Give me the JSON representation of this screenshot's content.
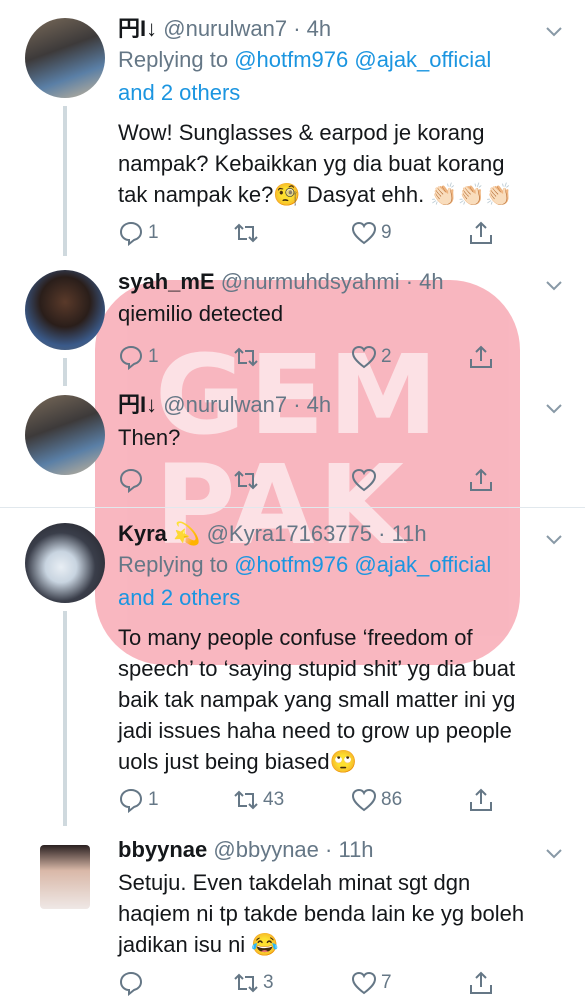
{
  "watermark": {
    "text": "GEM PAK"
  },
  "tweets": [
    {
      "name": "円I↓",
      "handle": "@nurulwan7",
      "time": "· 4h",
      "replying_prefix": "Replying to ",
      "replying_mentions": "@hotfm976 @ajak_official",
      "replying_others": "and 2 others",
      "body_lines": [
        "Wow! Sunglasses & earpod je korang",
        "nampak? Kebaikkan yg dia buat korang",
        "tak nampak ke?🧐 Dasyat ehh. 👏🏻👏🏻👏🏻"
      ],
      "replies": "1",
      "retweets": "",
      "likes": "9"
    },
    {
      "name": "syah_mE",
      "handle": "@nurmuhdsyahmi",
      "time": "· 4h",
      "body_lines": [
        "qiemilio detected"
      ],
      "replies": "1",
      "retweets": "",
      "likes": "2"
    },
    {
      "name": "円I↓",
      "handle": "@nurulwan7",
      "time": "· 4h",
      "body_lines": [
        "Then?"
      ],
      "replies": "",
      "retweets": "",
      "likes": ""
    },
    {
      "name": "Kyra 💫",
      "handle": "@Kyra17163775",
      "time": "· 11h",
      "replying_prefix": "Replying to ",
      "replying_mentions": "@hotfm976 @ajak_official",
      "replying_others": "and 2 others",
      "body_lines": [
        "To many people confuse ‘freedom of",
        "speech’ to ‘saying stupid shit’ yg dia buat",
        "baik tak nampak yang small matter ini yg",
        "jadi issues  haha need to grow up people",
        "uols just being biased🙄"
      ],
      "replies": "1",
      "retweets": "43",
      "likes": "86"
    },
    {
      "name": "bbyynae",
      "handle": "@bbyynae",
      "time": "· 11h",
      "body_lines": [
        "Setuju. Even takdelah minat sgt dgn",
        "haqiem ni tp takde benda lain ke yg boleh",
        "jadikan isu ni 😂"
      ],
      "replies": "",
      "retweets": "3",
      "likes": "7"
    }
  ],
  "icons": {
    "reply": "reply-icon",
    "retweet": "retweet-icon",
    "like": "heart-icon",
    "share": "share-icon",
    "caret": "chevron-down-icon"
  },
  "colors": {
    "link": "#1b95e0",
    "muted": "#657786",
    "text": "#14171a",
    "watermark": "#f47c8c"
  }
}
